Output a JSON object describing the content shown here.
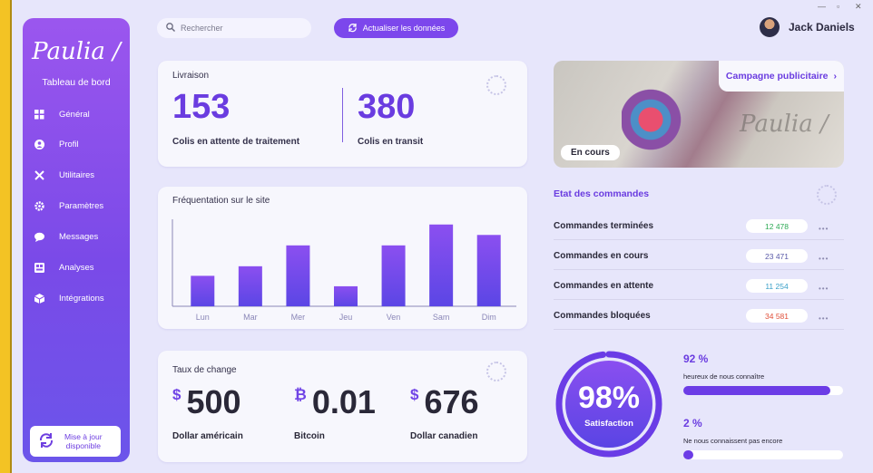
{
  "sidebar": {
    "logo": "Paulia /",
    "subtitle": "Tableau de bord",
    "items": [
      {
        "label": "Général",
        "icon": "grid-icon"
      },
      {
        "label": "Profil",
        "icon": "user-icon"
      },
      {
        "label": "Utilitaires",
        "icon": "tools-icon"
      },
      {
        "label": "Paramètres",
        "icon": "gear-icon"
      },
      {
        "label": "Messages",
        "icon": "chat-icon"
      },
      {
        "label": "Analyses",
        "icon": "analytics-icon"
      },
      {
        "label": "Intégrations",
        "icon": "cube-icon"
      }
    ],
    "update_line1": "Mise à jour",
    "update_line2": "disponible"
  },
  "topbar": {
    "search_placeholder": "Rechercher",
    "refresh_label": "Actualiser les données",
    "user_name": "Jack Daniels"
  },
  "livraison": {
    "title": "Livraison",
    "pending_value": "153",
    "pending_label": "Colis en attente de traitement",
    "transit_value": "380",
    "transit_label": "Colis en transit"
  },
  "traffic": {
    "title": "Fréquentation sur le site"
  },
  "chart_data": {
    "type": "bar",
    "categories": [
      "Lun",
      "Mar",
      "Mer",
      "Jeu",
      "Ven",
      "Sam",
      "Dim"
    ],
    "values": [
      35,
      46,
      70,
      23,
      70,
      94,
      82
    ],
    "ylim": [
      0,
      100
    ],
    "title": "Fréquentation sur le site",
    "grid": false,
    "colors": {
      "top": "#8b4ff0",
      "bottom": "#5b46e5"
    }
  },
  "exchange": {
    "title": "Taux de change",
    "currencies": [
      {
        "symbol": "$",
        "value": "500",
        "name": "Dollar américain"
      },
      {
        "symbol": "₿",
        "value": "0.01",
        "name": "Bitcoin"
      },
      {
        "symbol": "$",
        "value": "676",
        "name": "Dollar canadien"
      }
    ]
  },
  "campaign": {
    "link_label": "Campagne publicitaire",
    "status": "En cours",
    "signature": "Paulia /"
  },
  "orders": {
    "title": "Etat des commandes",
    "rows": [
      {
        "label": "Commandes terminées",
        "value": "12 478",
        "color": "#2eaa55"
      },
      {
        "label": "Commandes en cours",
        "value": "23 471",
        "color": "#5a5aa8"
      },
      {
        "label": "Commandes en attente",
        "value": "11 254",
        "color": "#3aa0c8"
      },
      {
        "label": "Commandes bloquées",
        "value": "34 581",
        "color": "#e0503a"
      }
    ]
  },
  "satisfaction": {
    "percent_label": "98%",
    "percent": 98,
    "label": "Satisfaction",
    "stats": [
      {
        "pct_label": "92 %",
        "pct": 0.92,
        "text": "heureux de nous connaître"
      },
      {
        "pct_label": "2 %",
        "pct": 0.02,
        "text": "Ne nous connaissent pas encore"
      }
    ]
  },
  "colors": {
    "accent": "#6a3ce0",
    "sidebar": "#8a50ec"
  }
}
